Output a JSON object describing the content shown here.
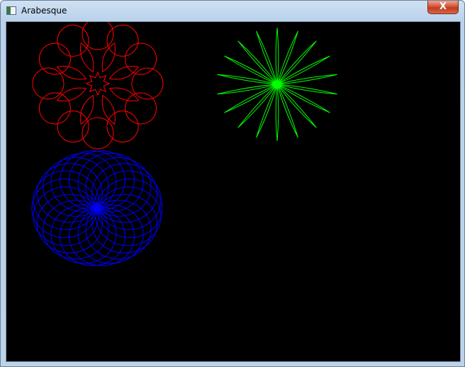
{
  "window": {
    "title": "Arabesque",
    "app_icon": "window-app-icon",
    "close_icon": "close-icon",
    "close_glyph": "X"
  },
  "canvas": {
    "background": "#000000",
    "figures": [
      {
        "name": "red-rosette",
        "color": "#ff0000"
      },
      {
        "name": "green-star",
        "color": "#00ff00"
      },
      {
        "name": "blue-spirograph",
        "color": "#0000ff"
      }
    ]
  }
}
